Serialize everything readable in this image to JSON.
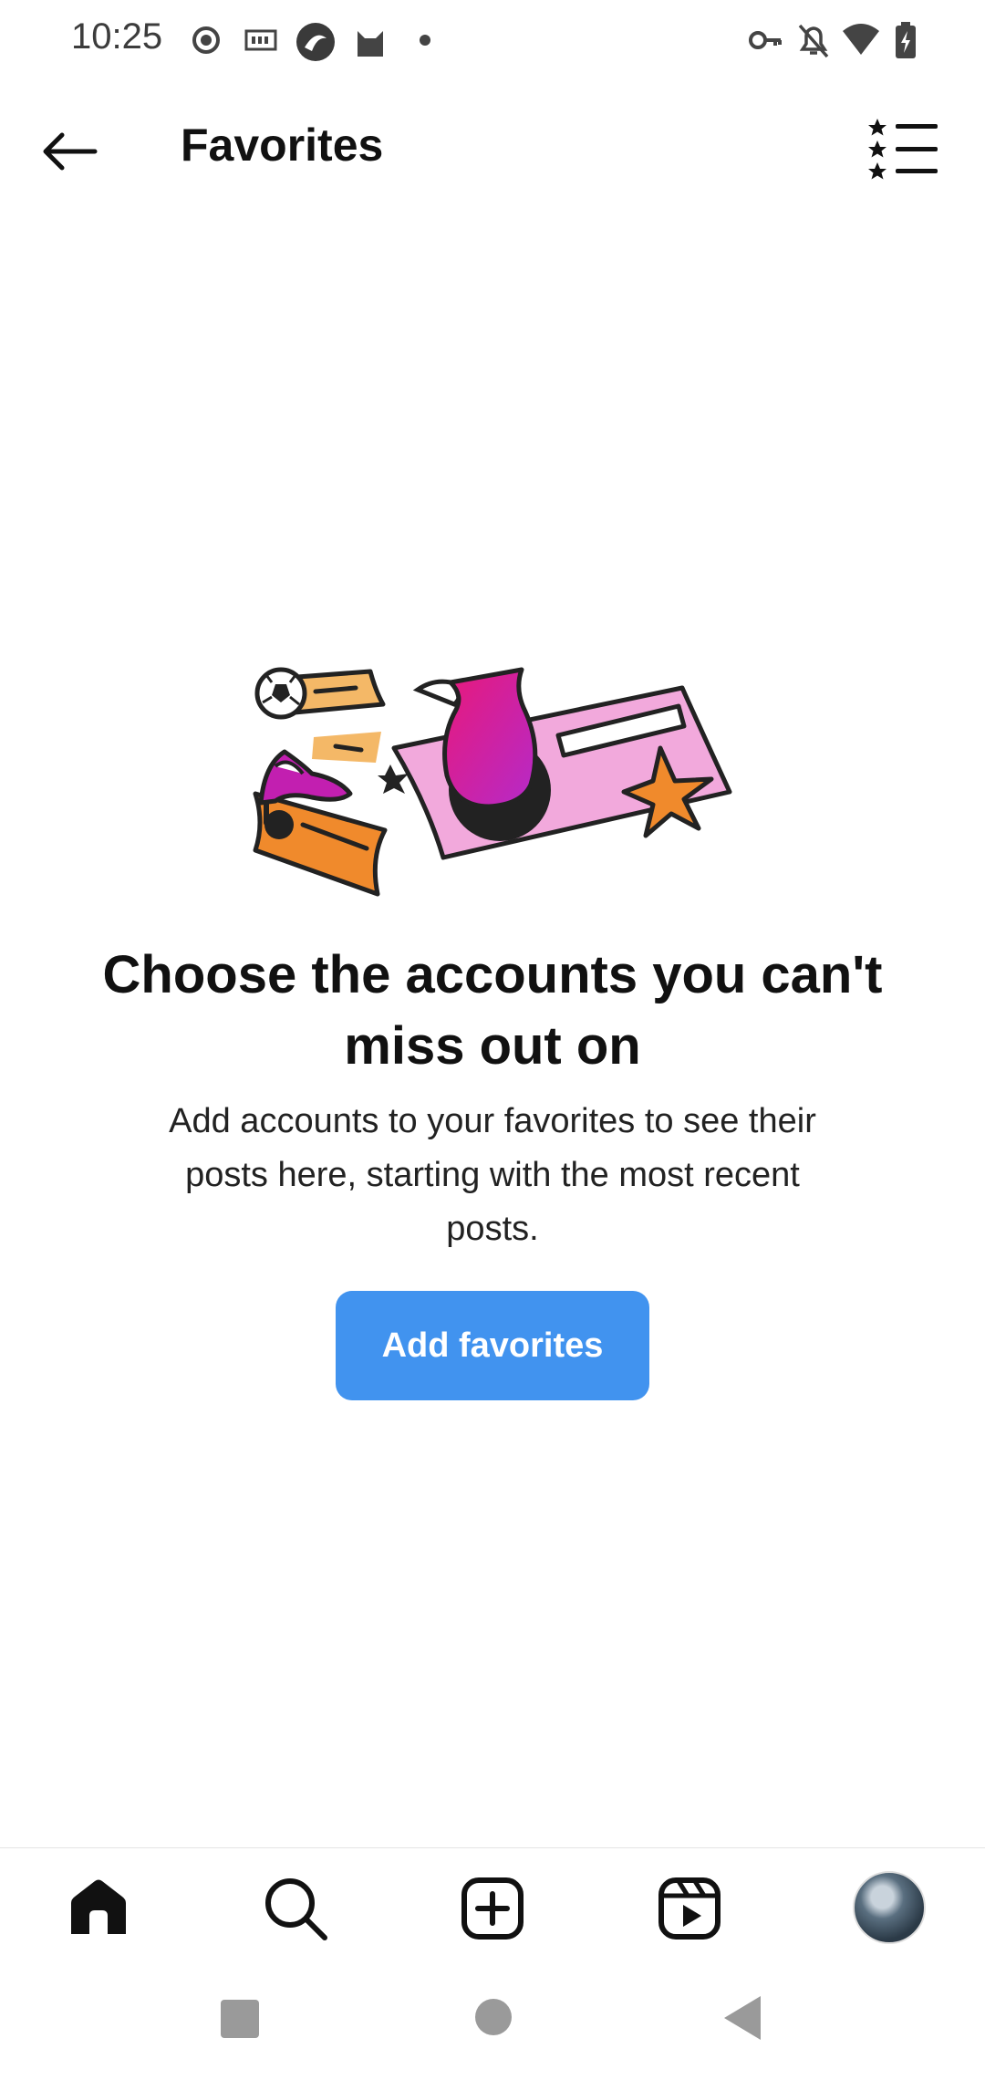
{
  "status_bar": {
    "time": "10:25",
    "left_icons": [
      "record-icon",
      "iqiyi-icon",
      "browser-icon",
      "cat-icon",
      "dot-icon"
    ],
    "right_icons": [
      "key-icon",
      "bell-off-icon",
      "wifi-icon",
      "battery-charging-icon"
    ]
  },
  "header": {
    "title": "Favorites",
    "back_icon": "arrow-left-icon",
    "menu_icon": "starred-list-icon"
  },
  "empty_state": {
    "headline": "Choose the accounts you can't miss out on",
    "description": "Add accounts to your favorites to see their posts here, starting with the most recent posts.",
    "button_label": "Add favorites",
    "colors": {
      "button": "#4193ef",
      "pink": "#f2a9dc",
      "orange": "#f08a2c",
      "light_orange": "#f4b867",
      "magenta": "#c21fb0"
    }
  },
  "bottom_nav": {
    "items": [
      "home-icon",
      "search-icon",
      "create-icon",
      "reels-icon",
      "profile-avatar"
    ]
  },
  "system_nav": {
    "items": [
      "recents-square-icon",
      "home-circle-icon",
      "back-triangle-icon"
    ]
  }
}
